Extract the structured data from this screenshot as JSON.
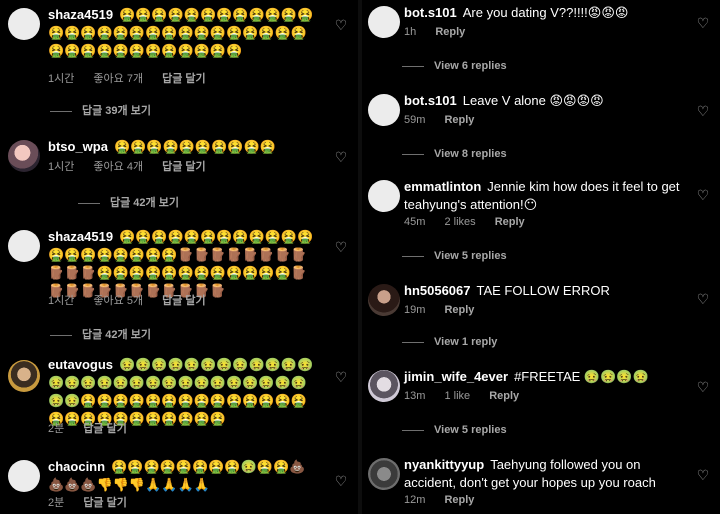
{
  "left": {
    "comments": [
      {
        "username": "shaza4519",
        "text": "🤮🤮🤮🤮🤮🤮🤮🤮🤮🤮🤮🤮🤮🤮🤮🤮🤮🤮🤮🤮🤮🤮🤮🤮🤮🤮🤮🤮🤮🤮🤮🤮🤮🤮🤮🤮🤮🤮🤮🤮",
        "time": "1시간",
        "likes": "좋아요 7개",
        "reply": "답글 달기",
        "view_replies": "답글 39개 보기"
      },
      {
        "username": "btso_wpa",
        "text": "🤮🤮🤮🤮🤮🤮🤮🤮🤮🤮",
        "time": "1시간",
        "likes": "좋아요 4개",
        "reply": "답글 달기",
        "view_replies": "답글 42개 보기"
      },
      {
        "username": "shaza4519",
        "text": "🤮🤮🤮🤮🤮🤮🤮🤮🤮🤮🤮🤮🤮🤮🤮🤮🤮🤮🤮🤮🪵🪵🪵🪵🪵🪵🪵🪵🪵🪵🪵🤮🤮🤮🤮🤮🤮🤮🤮🤮🤮🤮🤮🪵🪵🪵🪵🪵🪵🪵🪵🪵🪵🪵🪵",
        "time": "1시간",
        "likes": "좋아요 5개",
        "reply": "답글 달기",
        "view_replies": "답글 42개 보기"
      },
      {
        "username": "eutavogus",
        "text": "🤢🤢🤢🤢🤢🤢🤢🤢🤢🤢🤢🤢🤢🤢🤢🤢🤢🤢🤢🤢🤢🤢🤢🤢🤢🤢🤢🤢🤢🤢🤮🤮🤮🤮🤮🤮🤮🤮🤮🤮🤮🤮🤮🤮🤮🤮🤮🤮🤮🤮🤮🤮🤮🤮🤮",
        "time": "2분",
        "likes": "",
        "reply": "답글 달기",
        "view_replies": ""
      },
      {
        "username": "chaocinn",
        "text": "🤮🤮🤮🤮🤮🤮🤮🤮🤢🤮🤮💩💩💩💩👎👎👎🙏🙏🙏🙏",
        "time": "2분",
        "likes": "",
        "reply": "답글 달기",
        "view_replies": ""
      }
    ]
  },
  "right": {
    "comments": [
      {
        "username": "bot.s101",
        "text": "Are you dating V??!!!!😡😡😡",
        "time": "1h",
        "likes": "",
        "reply": "Reply",
        "view_replies": "View 6 replies"
      },
      {
        "username": "bot.s101",
        "text": "Leave V alone 😡😡😡😡",
        "time": "59m",
        "likes": "",
        "reply": "Reply",
        "view_replies": "View 8 replies"
      },
      {
        "username": "emmatlinton",
        "text": "Jennie kim how does it feel to get teahyung's attention!😶",
        "time": "45m",
        "likes": "2 likes",
        "reply": "Reply",
        "view_replies": "View 5 replies"
      },
      {
        "username": "hn5056067",
        "text": "TAE FOLLOW ERROR",
        "time": "19m",
        "likes": "",
        "reply": "Reply",
        "view_replies": "View 1 reply"
      },
      {
        "username": "jimin_wife_4ever",
        "text": "#FREETAE 🤢🤢🤢🤢",
        "time": "13m",
        "likes": "1 like",
        "reply": "Reply",
        "view_replies": "View 5 replies"
      },
      {
        "username": "nyankittyyup",
        "text": "Taehyung followed you on accident, don't get your hopes up you roach",
        "time": "12m",
        "likes": "",
        "reply": "Reply",
        "view_replies": ""
      }
    ]
  }
}
